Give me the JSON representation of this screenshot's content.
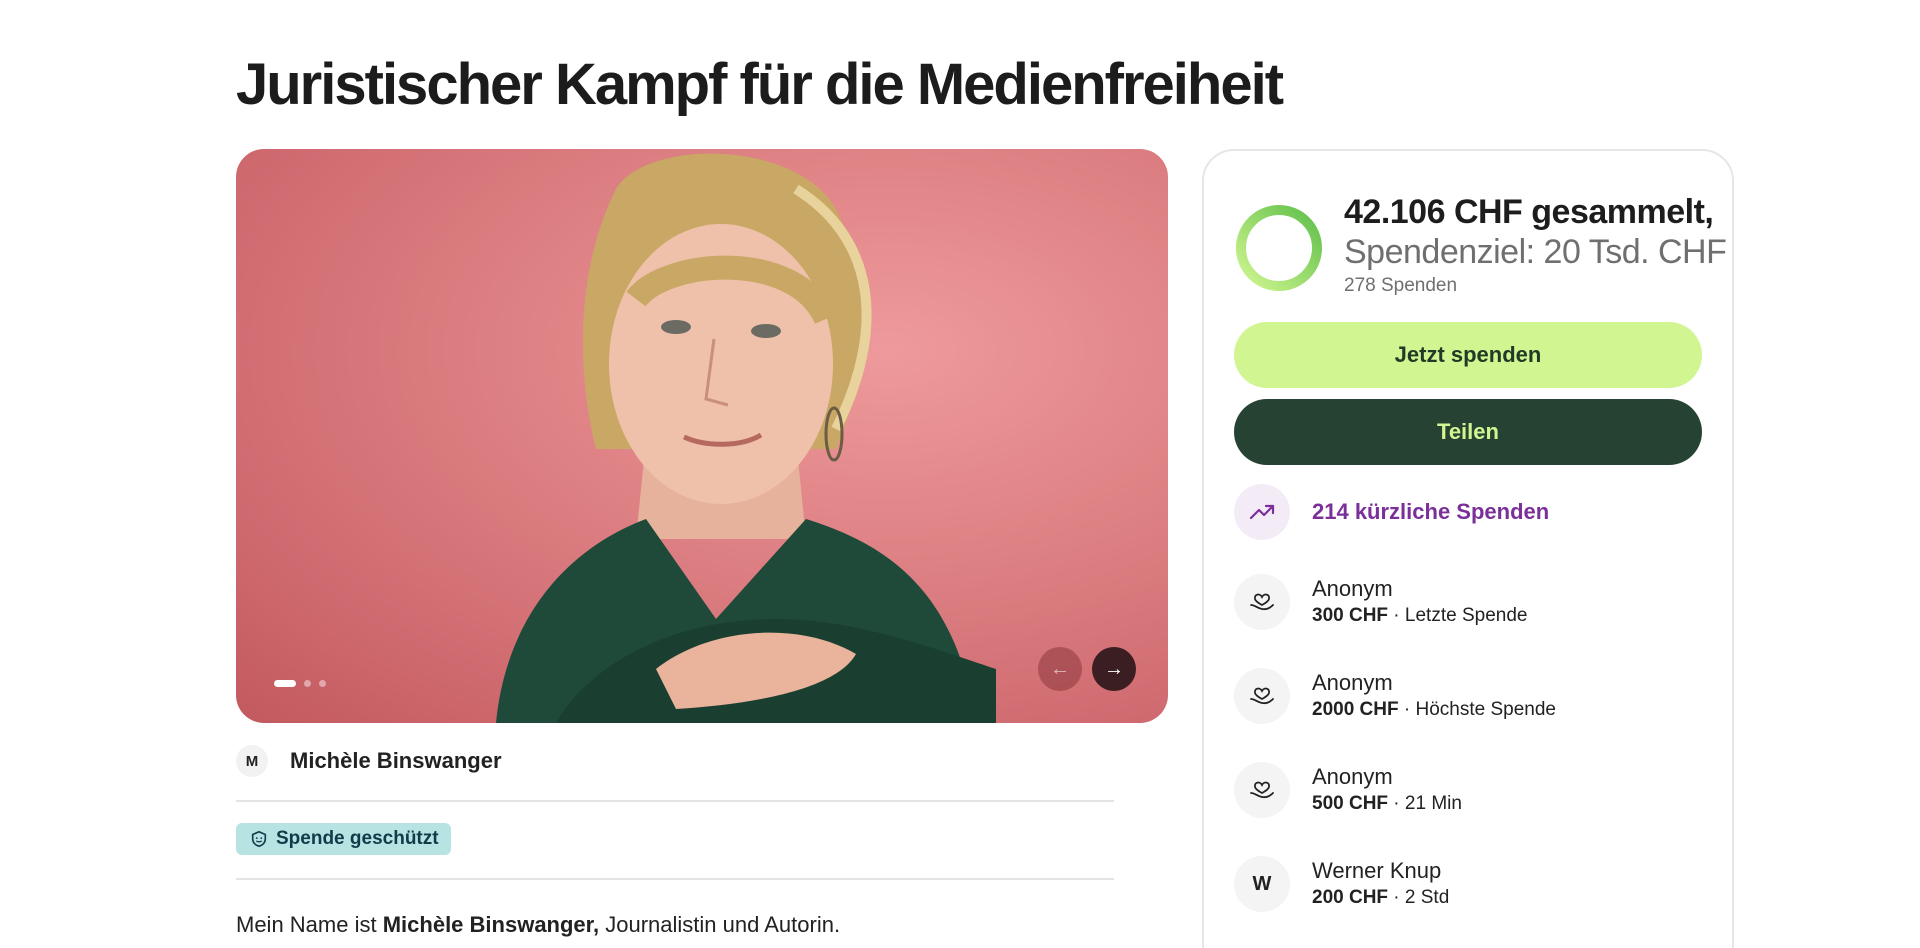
{
  "page": {
    "title": "Juristischer Kampf für die Medienfreiheit"
  },
  "gallery": {
    "slide_count": 3,
    "active_slide": 1,
    "prev_icon": "arrow-left-icon",
    "next_icon": "arrow-right-icon",
    "prev_glyph": "←",
    "next_glyph": "→"
  },
  "organizer": {
    "initial": "M",
    "name": "Michèle Binswanger"
  },
  "protection": {
    "label": "Spende geschützt",
    "icon": "shield-icon"
  },
  "story": {
    "intro_prefix": "Mein Name ist ",
    "intro_bold": "Michèle Binswanger,",
    "intro_suffix": " Journalistin und Autorin."
  },
  "fundraiser": {
    "raised": "42.106 CHF gesammelt,",
    "goal": "Spendenziel: 20 Tsd. CHF",
    "donation_count": "278 Spenden",
    "progress_fraction": 1.0,
    "donate_label": "Jetzt spenden",
    "share_label": "Teilen",
    "recent_label": "214 kürzliche Spenden",
    "recent_icon": "trending-up-icon"
  },
  "donations": [
    {
      "name": "Anonym",
      "amount": "300 CHF",
      "detail": " · Letzte Spende",
      "icon": "heart-hand-icon"
    },
    {
      "name": "Anonym",
      "amount": "2000 CHF",
      "detail": " · Höchste Spende",
      "icon": "heart-hand-icon"
    },
    {
      "name": "Anonym",
      "amount": "500 CHF",
      "detail": " · 21 Min",
      "icon": "heart-hand-icon"
    },
    {
      "name": "Werner Knup",
      "amount": "200 CHF",
      "detail": " · 2 Std",
      "initial": "W"
    }
  ],
  "colors": {
    "accent_green": "#d1f691",
    "dark_green": "#264232",
    "purple": "#7a2f99",
    "protect_bg": "#b7e3e3"
  }
}
